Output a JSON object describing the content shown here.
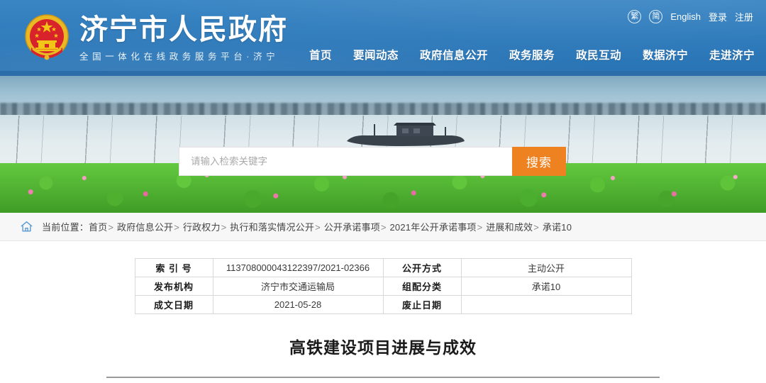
{
  "header": {
    "emblem_icon": "china-national-emblem",
    "site_title": "济宁市人民政府",
    "site_subtitle": "全国一体化在线政务服务平台·济宁",
    "brand_color": "#2d79ba",
    "utility": {
      "traditional_label": "繁",
      "simplified_label": "简",
      "english_label": "English",
      "login_label": "登录",
      "register_label": "注册"
    },
    "nav": [
      {
        "label": "首页"
      },
      {
        "label": "要闻动态"
      },
      {
        "label": "政府信息公开"
      },
      {
        "label": "政务服务"
      },
      {
        "label": "政民互动"
      },
      {
        "label": "数据济宁"
      },
      {
        "label": "走进济宁"
      }
    ]
  },
  "banner": {
    "scene_description": "微山湖荷花与渔船",
    "search": {
      "placeholder": "请输入检索关键字",
      "value": "",
      "button_label": "搜索",
      "button_color": "#ef8220"
    }
  },
  "breadcrumb": {
    "home_icon": "home-icon",
    "prefix": "当前位置：",
    "items": [
      "首页",
      "政府信息公开",
      "行政权力",
      "执行和落实情况公开",
      "公开承诺事项",
      "2021年公开承诺事项",
      "进展和成效",
      "承诺10"
    ],
    "separator": ">"
  },
  "info_table": {
    "rows": [
      {
        "label_left": "索 引 号",
        "value_left": "113708000043122397/2021-02366",
        "label_right": "公开方式",
        "value_right": "主动公开"
      },
      {
        "label_left": "发布机构",
        "value_left": "济宁市交通运输局",
        "label_right": "组配分类",
        "value_right": "承诺10"
      },
      {
        "label_left": "成文日期",
        "value_left": "2021-05-28",
        "label_right": "废止日期",
        "value_right": ""
      }
    ]
  },
  "article": {
    "title": "高铁建设项目进展与成效"
  }
}
